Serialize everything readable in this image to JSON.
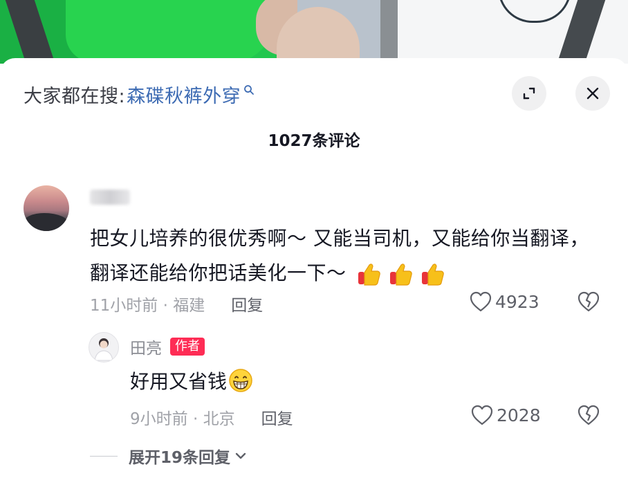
{
  "search": {
    "prefix": "大家都在搜:",
    "term": "森碟秋裤外穿"
  },
  "header": {
    "comment_count": "1027条评论"
  },
  "comment": {
    "text": "把女儿培养的很优秀啊～ 又能当司机，又能给你当翻译，翻译还能给你把话美化一下～",
    "emojis": [
      "thumbs-up",
      "thumbs-up",
      "thumbs-up"
    ],
    "time_location": "11小时前 · 福建",
    "reply_label": "回复",
    "likes": "4923"
  },
  "reply": {
    "author": "田亮",
    "badge": "作者",
    "text": "好用又省钱",
    "emoji": "grinning-face",
    "time_location": "9小时前 · 北京",
    "reply_label": "回复",
    "likes": "2028"
  },
  "expand": {
    "label": "展开19条回复"
  },
  "colors": {
    "link": "#3d6bb3",
    "author_badge": "#fe2c55",
    "muted": "#a0a2a8"
  }
}
